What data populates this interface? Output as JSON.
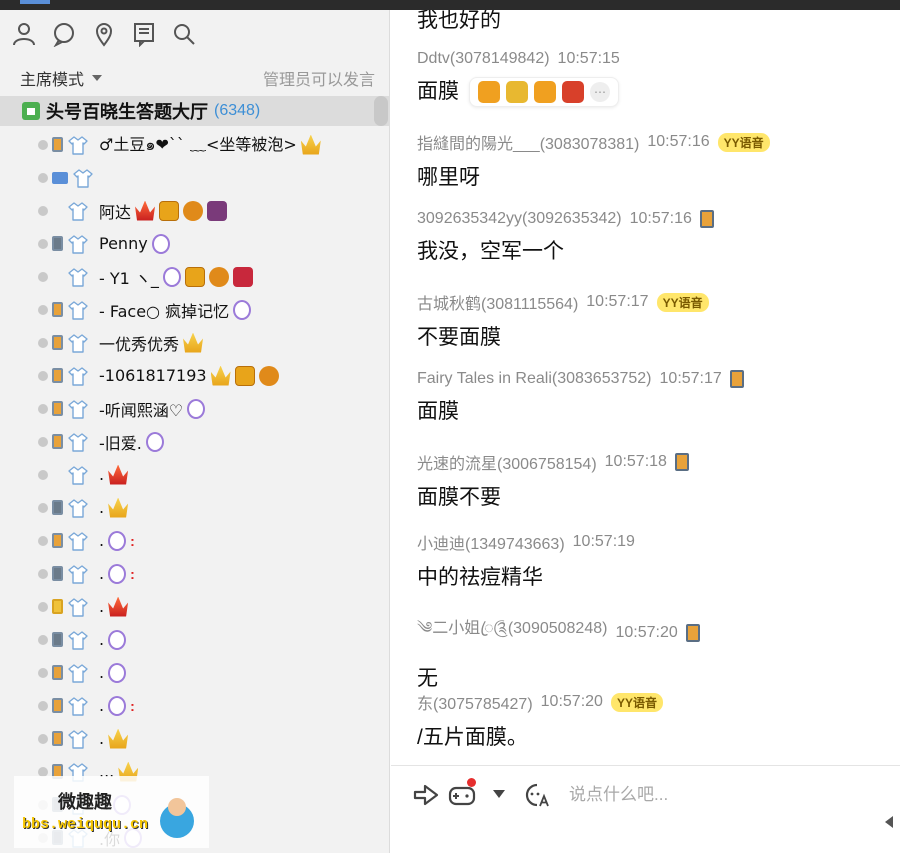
{
  "sidebar": {
    "mode_label": "主席模式",
    "mode_note": "管理员可以发言",
    "channel": {
      "name": "头号百晓生答题大厅",
      "count": "(6348)"
    },
    "members": [
      {
        "name": "♂土豆๑❤`` ﹏<坐等被泡>",
        "device": "orange",
        "badges": [
          "crown"
        ]
      },
      {
        "name": "",
        "device": "pc",
        "badges": []
      },
      {
        "name": "阿达",
        "device": "none",
        "badges": [
          "redcrown",
          "gold",
          "owl",
          "dark"
        ]
      },
      {
        "name": "Penny",
        "device": "gray",
        "badges": [
          "purple"
        ]
      },
      {
        "name": "- Y1 ヽ_",
        "device": "none",
        "badges": [
          "purple",
          "gold",
          "owl",
          "red"
        ]
      },
      {
        "name": "- Face○ 疯掉记忆",
        "device": "orange",
        "badges": [
          "purple"
        ]
      },
      {
        "name": "一优秀优秀",
        "device": "orange",
        "badges": [
          "crown"
        ]
      },
      {
        "name": "-1061817193",
        "device": "orange",
        "badges": [
          "crown",
          "gold",
          "owl"
        ]
      },
      {
        "name": "-听闻熙涵♡",
        "device": "orange",
        "badges": [
          "purple"
        ]
      },
      {
        "name": "-旧爱.",
        "device": "orange",
        "badges": [
          "purple"
        ]
      },
      {
        "name": ".",
        "device": "none",
        "badges": [
          "redcrown"
        ]
      },
      {
        "name": ".",
        "device": "gray",
        "badges": [
          "crown"
        ]
      },
      {
        "name": ".",
        "device": "orange",
        "badges": [
          "purple",
          "redmark"
        ]
      },
      {
        "name": ".",
        "device": "gray",
        "badges": [
          "purple",
          "redmark"
        ]
      },
      {
        "name": ".",
        "device": "yellow",
        "badges": [
          "redcrown"
        ]
      },
      {
        "name": ".",
        "device": "gray",
        "badges": [
          "purple"
        ]
      },
      {
        "name": ".",
        "device": "orange",
        "badges": [
          "purple"
        ]
      },
      {
        "name": ".",
        "device": "orange",
        "badges": [
          "purple",
          "redmark"
        ]
      },
      {
        "name": ".",
        "device": "orange",
        "badges": [
          "crown"
        ]
      },
      {
        "name": "...",
        "device": "orange",
        "badges": [
          "crown"
        ]
      },
      {
        "name": "..",
        "device": "gray",
        "badges": [
          "purple"
        ]
      },
      {
        "name": ".你",
        "device": "gray",
        "badges": [
          "purple"
        ]
      }
    ]
  },
  "chat": {
    "cutoff_text": "我也好的",
    "messages": [
      {
        "sender": "Ddtv(3078149842)",
        "time": "10:57:15",
        "text": "面膜",
        "tag": "",
        "reactions": true
      },
      {
        "sender": "指縫間的陽光___(3083078381)",
        "time": "10:57:16",
        "text": "哪里呀",
        "tag": "YY语音"
      },
      {
        "sender": "3092635342yy(3092635342)",
        "time": "10:57:16",
        "text": "我没，空军一个",
        "tag": "phone"
      },
      {
        "sender": "古城秋鹤(3081115564)",
        "time": "10:57:17",
        "text": "不要面膜",
        "tag": "YY语音"
      },
      {
        "sender": "Fairy Tales in Reali(3083653752)",
        "time": "10:57:17",
        "text": "面膜",
        "tag": "phone"
      },
      {
        "sender": "光速的流星(3006758154)",
        "time": "10:57:18",
        "text": "面膜不要",
        "tag": "phone"
      },
      {
        "sender": "小迪迪(1349743663)",
        "time": "10:57:19",
        "text": "中的祛痘精华",
        "tag": ""
      },
      {
        "sender": "༄二小姐ꦿ༊(3090508248)",
        "time": "10:57:20",
        "text": "无",
        "tag": "phone"
      },
      {
        "sender": "东(3075785427)",
        "time": "10:57:20",
        "text": "/五片面膜。",
        "tag": "YY语音"
      }
    ]
  },
  "input": {
    "placeholder": "说点什么吧..."
  },
  "watermark": {
    "top": "微趣趣",
    "bottom": "bbs.weiququ.cn"
  },
  "colors": {
    "accent": "#3d8fd6",
    "yy_tag": "#ffe66b"
  }
}
